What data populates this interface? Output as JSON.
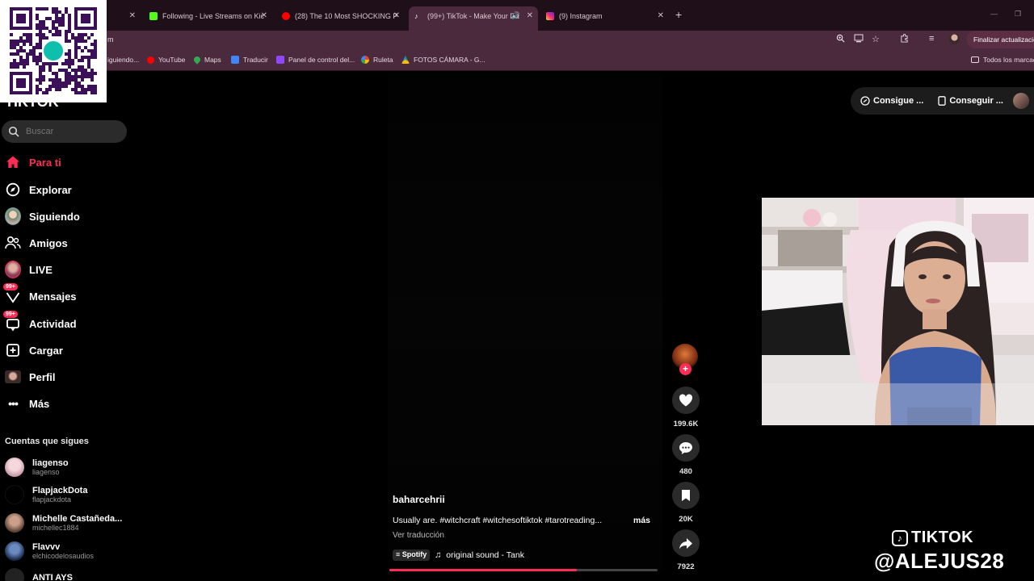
{
  "browser": {
    "tabs": [
      {
        "title": "Following - Live Streams on Kic",
        "favicon_color": "#53fc18"
      },
      {
        "title": "(28) The 10 Most SHOCKING P",
        "favicon_color": "#ff0000"
      },
      {
        "title": "(99+) TikTok - Make Your Da",
        "favicon_color": "#ffffff"
      },
      {
        "title": "(9) Instagram",
        "favicon_color": "#e1306c"
      }
    ],
    "address_fragment": "m",
    "finish_update_label": "Finalizar actualizació",
    "bookmarks": [
      {
        "label": "iguiendo...",
        "icon_color": "#e0e0e0"
      },
      {
        "label": "YouTube",
        "icon_color": "#ff0000"
      },
      {
        "label": "Maps",
        "icon_color": "#34a853"
      },
      {
        "label": "Traducir",
        "icon_color": "#4285f4"
      },
      {
        "label": "Panel de control del...",
        "icon_color": "#9146ff"
      },
      {
        "label": "Ruleta",
        "icon_color": "#fbbc05"
      },
      {
        "label": "FOTOS CÁMARA - G...",
        "icon_color": "#0f9d58"
      }
    ],
    "all_bookmarks_label": "Todos los marcad"
  },
  "tiktok": {
    "logo_text": "TIKTOK",
    "search_placeholder": "Buscar",
    "nav": [
      {
        "label": "Para ti",
        "icon": "home-icon",
        "active": true
      },
      {
        "label": "Explorar",
        "icon": "compass-icon"
      },
      {
        "label": "Siguiendo",
        "icon": "following-avatar-icon"
      },
      {
        "label": "Amigos",
        "icon": "friends-icon"
      },
      {
        "label": "LIVE",
        "icon": "live-avatar-icon"
      },
      {
        "label": "Mensajes",
        "icon": "messages-icon",
        "badge": "99+"
      },
      {
        "label": "Actividad",
        "icon": "activity-icon",
        "badge": "99+"
      },
      {
        "label": "Cargar",
        "icon": "upload-icon"
      },
      {
        "label": "Perfil",
        "icon": "profile-avatar-icon"
      },
      {
        "label": "Más",
        "icon": "more-icon"
      }
    ],
    "following_title": "Cuentas que sigues",
    "following": [
      {
        "name": "liagenso",
        "handle": "liagenso",
        "avatar_color": "#e8c8d0"
      },
      {
        "name": "FlapjackDota",
        "handle": "flapjackdota",
        "avatar_color": "#000000"
      },
      {
        "name": "Michelle Castañeda...",
        "handle": "michellec1884",
        "avatar_color": "#8a6a5a"
      },
      {
        "name": "Flavvv",
        "handle": "elchicodelosaudios",
        "avatar_color": "#3a5a8a"
      },
      {
        "name": "ANTI AYS",
        "handle": "",
        "avatar_color": "#222222"
      }
    ],
    "top_buttons": [
      {
        "label": "Consigue ...",
        "icon": "coin-icon"
      },
      {
        "label": "Conseguir ...",
        "icon": "phone-icon"
      }
    ],
    "video": {
      "username": "baharcehrii",
      "caption": "Usually are.  #witchcraft #witchesoftiktok #tarotreading...",
      "more_label": "más",
      "translate_label": "Ver traducción",
      "spotify_label": "Spotify",
      "sound": "original sound - Tank",
      "progress": 0.7
    },
    "actions": {
      "likes": "199.6K",
      "comments": "480",
      "saves": "20K",
      "shares": "7922"
    }
  },
  "watermark": {
    "line1": "TIKTOK",
    "line2": "@ALEJUS28"
  }
}
